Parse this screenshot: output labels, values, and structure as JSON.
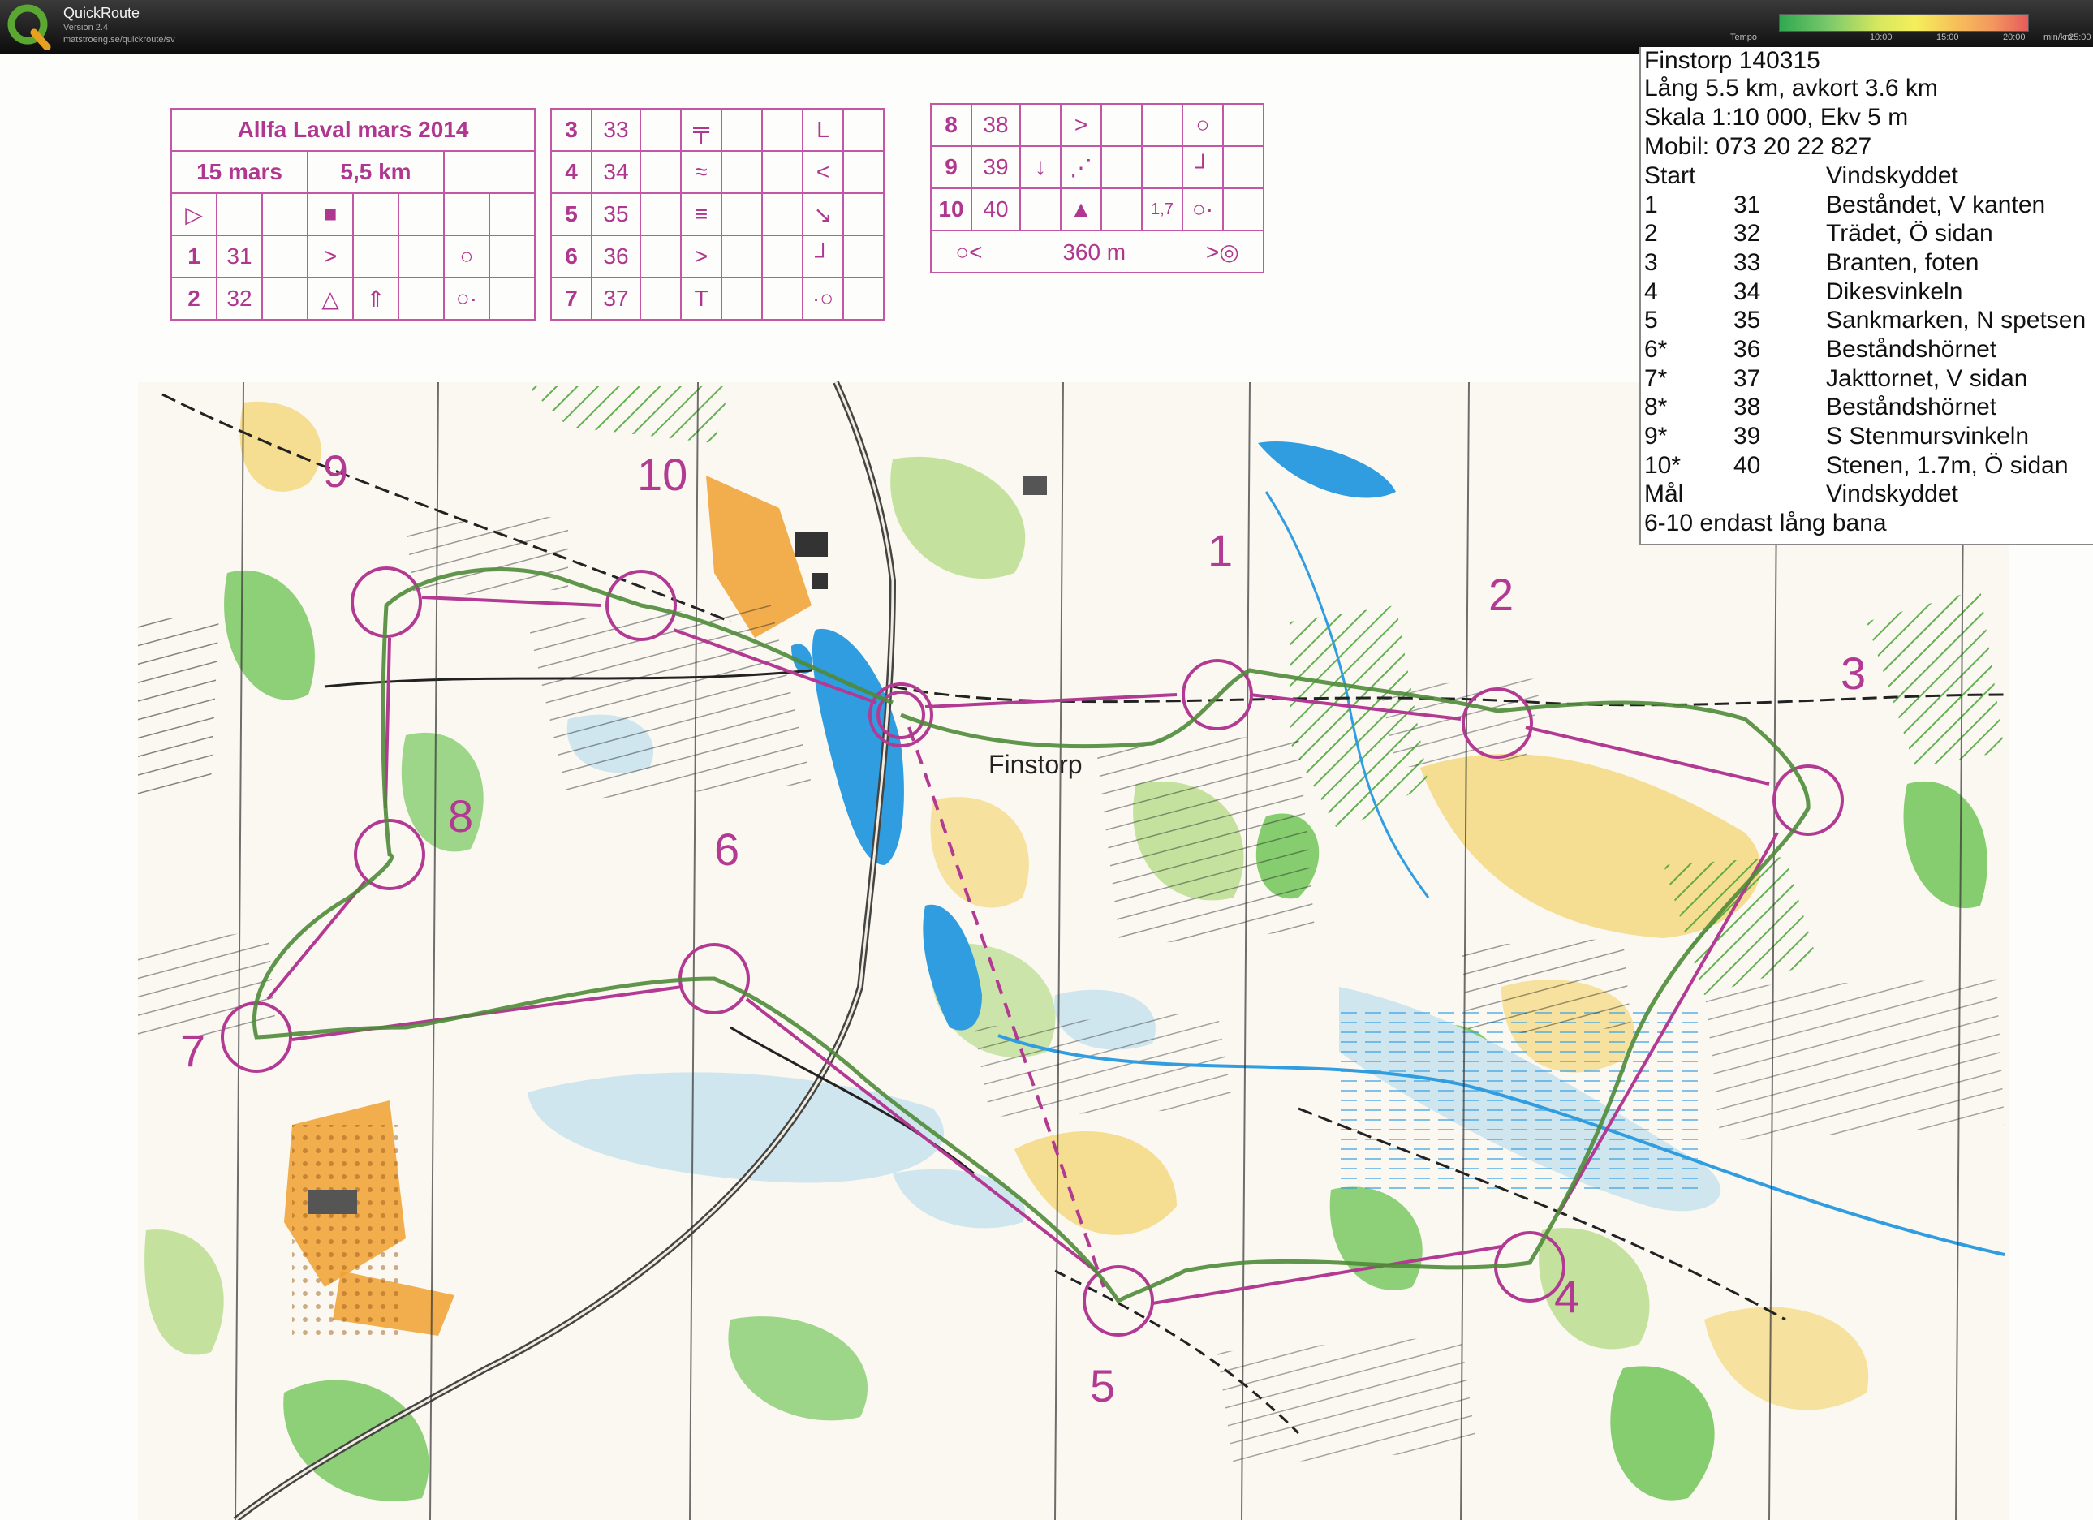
{
  "app": {
    "title": "QuickRoute",
    "version": "Version 2.4",
    "url": "matstroeng.se/quickroute/sv"
  },
  "tempo": {
    "label": "Tempo",
    "ticks": [
      "10:00",
      "15:00",
      "20:00",
      "25:00"
    ],
    "unit": "min/km"
  },
  "control_card": {
    "title": "Allfa Laval mars 2014",
    "date": "15 mars",
    "length": "5,5 km",
    "rows_left": [
      {
        "n": "1",
        "code": "31"
      },
      {
        "n": "2",
        "code": "32"
      }
    ],
    "rows_mid": [
      {
        "n": "3",
        "code": "33"
      },
      {
        "n": "4",
        "code": "34"
      },
      {
        "n": "5",
        "code": "35"
      },
      {
        "n": "6",
        "code": "36"
      },
      {
        "n": "7",
        "code": "37"
      }
    ],
    "rows_right": [
      {
        "n": "8",
        "code": "38"
      },
      {
        "n": "9",
        "code": "39"
      },
      {
        "n": "10",
        "code": "40"
      }
    ],
    "height_note": "1,7",
    "finish_distance": "360 m"
  },
  "course_info": {
    "lines": [
      "Finstorp 140315",
      "Lång 5.5 km,  avkort 3.6 km",
      "Skala 1:10 000, Ekv 5 m",
      "Mobil: 073 20 22 827"
    ],
    "controls": [
      {
        "n": "Start",
        "code": "",
        "desc": "Vindskyddet"
      },
      {
        "n": "1",
        "code": "31",
        "desc": "Beståndet, V kanten"
      },
      {
        "n": "2",
        "code": "32",
        "desc": "Trädet, Ö sidan"
      },
      {
        "n": "3",
        "code": "33",
        "desc": "Branten, foten"
      },
      {
        "n": "4",
        "code": "34",
        "desc": "Dikesvinkeln"
      },
      {
        "n": "5",
        "code": "35",
        "desc": "Sankmarken, N spetsen"
      },
      {
        "n": "6*",
        "code": "36",
        "desc": "Beståndshörnet"
      },
      {
        "n": "7*",
        "code": "37",
        "desc": "Jakttornet, V sidan"
      },
      {
        "n": "8*",
        "code": "38",
        "desc": "Beståndshörnet"
      },
      {
        "n": "9*",
        "code": "39",
        "desc": "S Stenmursvinkeln"
      },
      {
        "n": "10*",
        "code": "40",
        "desc": "Stenen, 1.7m, Ö sidan"
      },
      {
        "n": "Mål",
        "code": "",
        "desc": "Vindskyddet"
      }
    ],
    "footer": "6-10 endast lång bana"
  },
  "map": {
    "place_name": "Finstorp",
    "control_labels": [
      "1",
      "2",
      "3",
      "4",
      "5",
      "6",
      "7",
      "8",
      "9",
      "10"
    ],
    "colors": {
      "course": "#b23a93",
      "route": "#4f8b3a",
      "forest_green": "#5fbf44",
      "light_green": "#b7dc8a",
      "open_yellow": "#f4d77a",
      "orange": "#f0a030",
      "water": "#2f9de0",
      "marsh": "#cfe6ef"
    }
  }
}
